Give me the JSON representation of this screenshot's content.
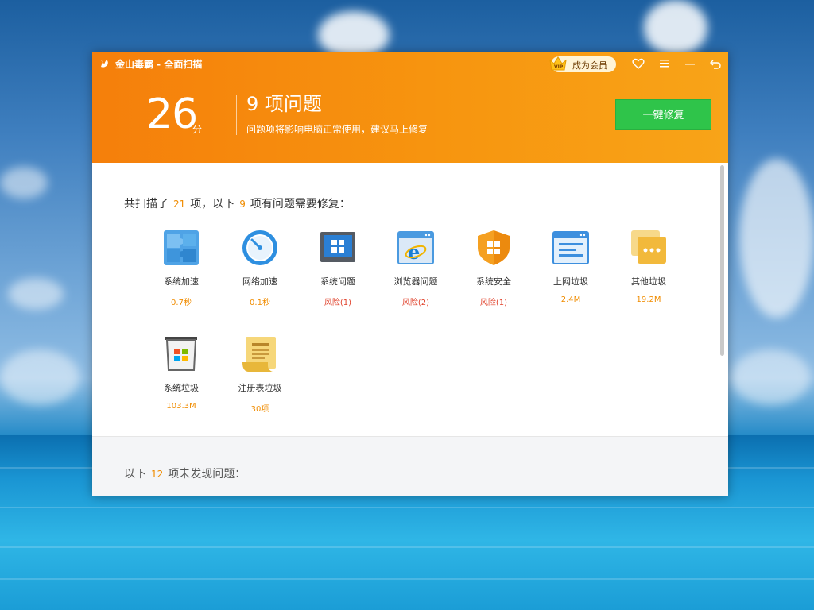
{
  "window": {
    "title": "金山毒霸 - 全面扫描",
    "vip_label": "成为会员",
    "vip_badge_text": "VIP"
  },
  "header": {
    "score": "26",
    "score_unit": "分",
    "issue_title": "9 项问题",
    "issue_subtitle": "问题项将影响电脑正常使用，建议马上修复",
    "fix_button": "一键修复"
  },
  "summary": {
    "prefix": "共扫描了",
    "scanned": "21",
    "mid": "项，以下",
    "problems": "9",
    "suffix": "项有问题需要修复："
  },
  "items": [
    {
      "name": "系统加速",
      "value": "0.7秒",
      "icon": "puzzle-icon",
      "risk": false
    },
    {
      "name": "网络加速",
      "value": "0.1秒",
      "icon": "speedometer-icon",
      "risk": false
    },
    {
      "name": "系统问题",
      "value": "风险(1)",
      "icon": "windows-monitor-icon",
      "risk": true
    },
    {
      "name": "浏览器问题",
      "value": "风险(2)",
      "icon": "ie-browser-icon",
      "risk": true
    },
    {
      "name": "系统安全",
      "value": "风险(1)",
      "icon": "shield-windows-icon",
      "risk": true
    },
    {
      "name": "上网垃圾",
      "value": "2.4M",
      "icon": "web-window-icon",
      "risk": false
    },
    {
      "name": "其他垃圾",
      "value": "19.2M",
      "icon": "folder-dots-icon",
      "risk": false
    },
    {
      "name": "系统垃圾",
      "value": "103.3M",
      "icon": "windows-trash-icon",
      "risk": false
    },
    {
      "name": "注册表垃圾",
      "value": "30项",
      "icon": "registry-scroll-icon",
      "risk": false
    }
  ],
  "footer": {
    "prefix": "以下",
    "count": "12",
    "suffix": "项未发现问题："
  },
  "colors": {
    "header_start": "#f57f0b",
    "header_end": "#f8a418",
    "fix_button": "#2fc44a",
    "accent_value": "#f08c00",
    "risk": "#e0402a"
  }
}
